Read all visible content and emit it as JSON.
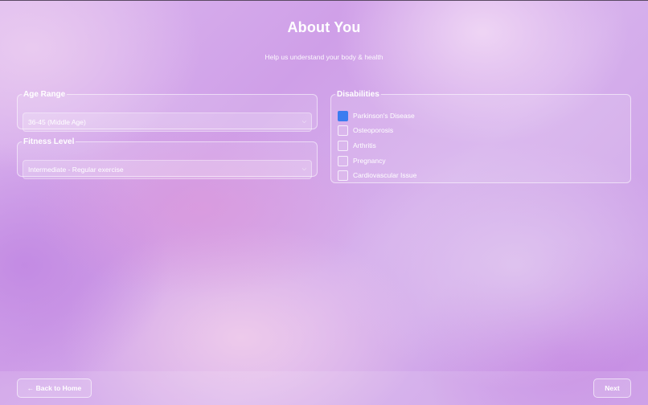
{
  "header": {
    "title": "About You",
    "subtitle": "Help us understand your body & health"
  },
  "age_range": {
    "label": "Age Range",
    "selected": "36-45 (Middle Age)"
  },
  "fitness_level": {
    "label": "Fitness Level",
    "selected": "Intermediate - Regular exercise"
  },
  "disabilities": {
    "label": "Disabilities",
    "items": [
      {
        "label": "Parkinson's Disease",
        "checked": true
      },
      {
        "label": "Osteoporosis",
        "checked": false
      },
      {
        "label": "Arthritis",
        "checked": false
      },
      {
        "label": "Pregnancy",
        "checked": false
      },
      {
        "label": "Cardiovascular Issue",
        "checked": false
      }
    ]
  },
  "footer": {
    "back_label": "← Back to Home",
    "next_label": "Next"
  },
  "icons": {
    "select_chevron": "chevron-down-icon",
    "back_arrow": "arrow-left-icon"
  },
  "colors": {
    "checkbox_checked": "#3b7cf0"
  }
}
